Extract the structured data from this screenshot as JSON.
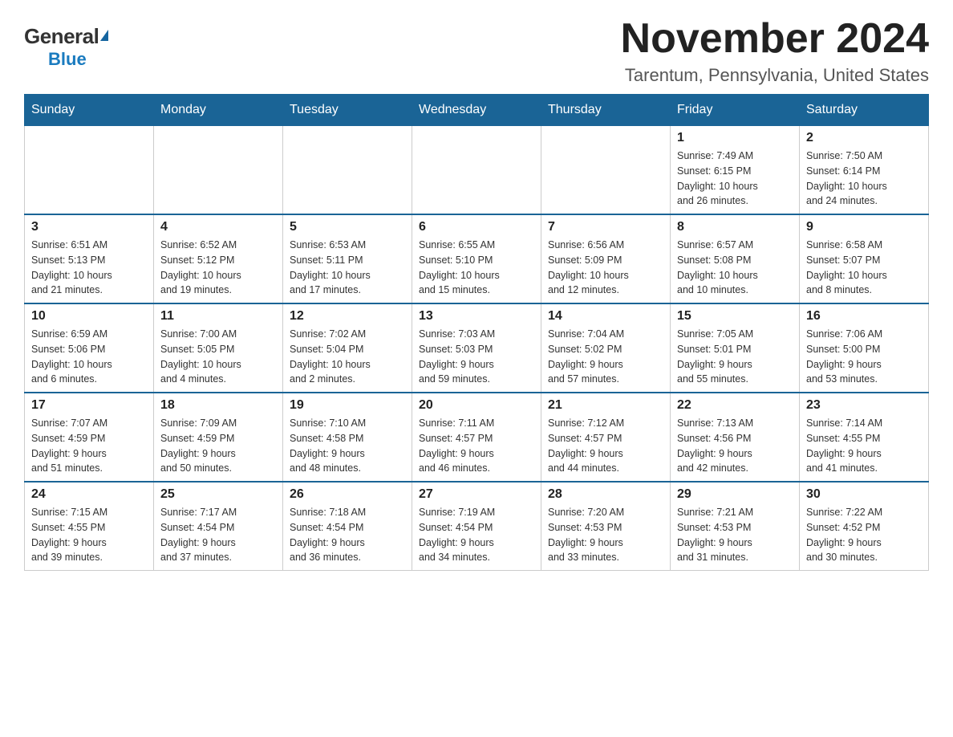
{
  "header": {
    "logo_general": "General",
    "logo_blue": "Blue",
    "month_title": "November 2024",
    "location": "Tarentum, Pennsylvania, United States"
  },
  "days_of_week": [
    "Sunday",
    "Monday",
    "Tuesday",
    "Wednesday",
    "Thursday",
    "Friday",
    "Saturday"
  ],
  "weeks": [
    [
      {
        "day": "",
        "info": ""
      },
      {
        "day": "",
        "info": ""
      },
      {
        "day": "",
        "info": ""
      },
      {
        "day": "",
        "info": ""
      },
      {
        "day": "",
        "info": ""
      },
      {
        "day": "1",
        "info": "Sunrise: 7:49 AM\nSunset: 6:15 PM\nDaylight: 10 hours\nand 26 minutes."
      },
      {
        "day": "2",
        "info": "Sunrise: 7:50 AM\nSunset: 6:14 PM\nDaylight: 10 hours\nand 24 minutes."
      }
    ],
    [
      {
        "day": "3",
        "info": "Sunrise: 6:51 AM\nSunset: 5:13 PM\nDaylight: 10 hours\nand 21 minutes."
      },
      {
        "day": "4",
        "info": "Sunrise: 6:52 AM\nSunset: 5:12 PM\nDaylight: 10 hours\nand 19 minutes."
      },
      {
        "day": "5",
        "info": "Sunrise: 6:53 AM\nSunset: 5:11 PM\nDaylight: 10 hours\nand 17 minutes."
      },
      {
        "day": "6",
        "info": "Sunrise: 6:55 AM\nSunset: 5:10 PM\nDaylight: 10 hours\nand 15 minutes."
      },
      {
        "day": "7",
        "info": "Sunrise: 6:56 AM\nSunset: 5:09 PM\nDaylight: 10 hours\nand 12 minutes."
      },
      {
        "day": "8",
        "info": "Sunrise: 6:57 AM\nSunset: 5:08 PM\nDaylight: 10 hours\nand 10 minutes."
      },
      {
        "day": "9",
        "info": "Sunrise: 6:58 AM\nSunset: 5:07 PM\nDaylight: 10 hours\nand 8 minutes."
      }
    ],
    [
      {
        "day": "10",
        "info": "Sunrise: 6:59 AM\nSunset: 5:06 PM\nDaylight: 10 hours\nand 6 minutes."
      },
      {
        "day": "11",
        "info": "Sunrise: 7:00 AM\nSunset: 5:05 PM\nDaylight: 10 hours\nand 4 minutes."
      },
      {
        "day": "12",
        "info": "Sunrise: 7:02 AM\nSunset: 5:04 PM\nDaylight: 10 hours\nand 2 minutes."
      },
      {
        "day": "13",
        "info": "Sunrise: 7:03 AM\nSunset: 5:03 PM\nDaylight: 9 hours\nand 59 minutes."
      },
      {
        "day": "14",
        "info": "Sunrise: 7:04 AM\nSunset: 5:02 PM\nDaylight: 9 hours\nand 57 minutes."
      },
      {
        "day": "15",
        "info": "Sunrise: 7:05 AM\nSunset: 5:01 PM\nDaylight: 9 hours\nand 55 minutes."
      },
      {
        "day": "16",
        "info": "Sunrise: 7:06 AM\nSunset: 5:00 PM\nDaylight: 9 hours\nand 53 minutes."
      }
    ],
    [
      {
        "day": "17",
        "info": "Sunrise: 7:07 AM\nSunset: 4:59 PM\nDaylight: 9 hours\nand 51 minutes."
      },
      {
        "day": "18",
        "info": "Sunrise: 7:09 AM\nSunset: 4:59 PM\nDaylight: 9 hours\nand 50 minutes."
      },
      {
        "day": "19",
        "info": "Sunrise: 7:10 AM\nSunset: 4:58 PM\nDaylight: 9 hours\nand 48 minutes."
      },
      {
        "day": "20",
        "info": "Sunrise: 7:11 AM\nSunset: 4:57 PM\nDaylight: 9 hours\nand 46 minutes."
      },
      {
        "day": "21",
        "info": "Sunrise: 7:12 AM\nSunset: 4:57 PM\nDaylight: 9 hours\nand 44 minutes."
      },
      {
        "day": "22",
        "info": "Sunrise: 7:13 AM\nSunset: 4:56 PM\nDaylight: 9 hours\nand 42 minutes."
      },
      {
        "day": "23",
        "info": "Sunrise: 7:14 AM\nSunset: 4:55 PM\nDaylight: 9 hours\nand 41 minutes."
      }
    ],
    [
      {
        "day": "24",
        "info": "Sunrise: 7:15 AM\nSunset: 4:55 PM\nDaylight: 9 hours\nand 39 minutes."
      },
      {
        "day": "25",
        "info": "Sunrise: 7:17 AM\nSunset: 4:54 PM\nDaylight: 9 hours\nand 37 minutes."
      },
      {
        "day": "26",
        "info": "Sunrise: 7:18 AM\nSunset: 4:54 PM\nDaylight: 9 hours\nand 36 minutes."
      },
      {
        "day": "27",
        "info": "Sunrise: 7:19 AM\nSunset: 4:54 PM\nDaylight: 9 hours\nand 34 minutes."
      },
      {
        "day": "28",
        "info": "Sunrise: 7:20 AM\nSunset: 4:53 PM\nDaylight: 9 hours\nand 33 minutes."
      },
      {
        "day": "29",
        "info": "Sunrise: 7:21 AM\nSunset: 4:53 PM\nDaylight: 9 hours\nand 31 minutes."
      },
      {
        "day": "30",
        "info": "Sunrise: 7:22 AM\nSunset: 4:52 PM\nDaylight: 9 hours\nand 30 minutes."
      }
    ]
  ]
}
